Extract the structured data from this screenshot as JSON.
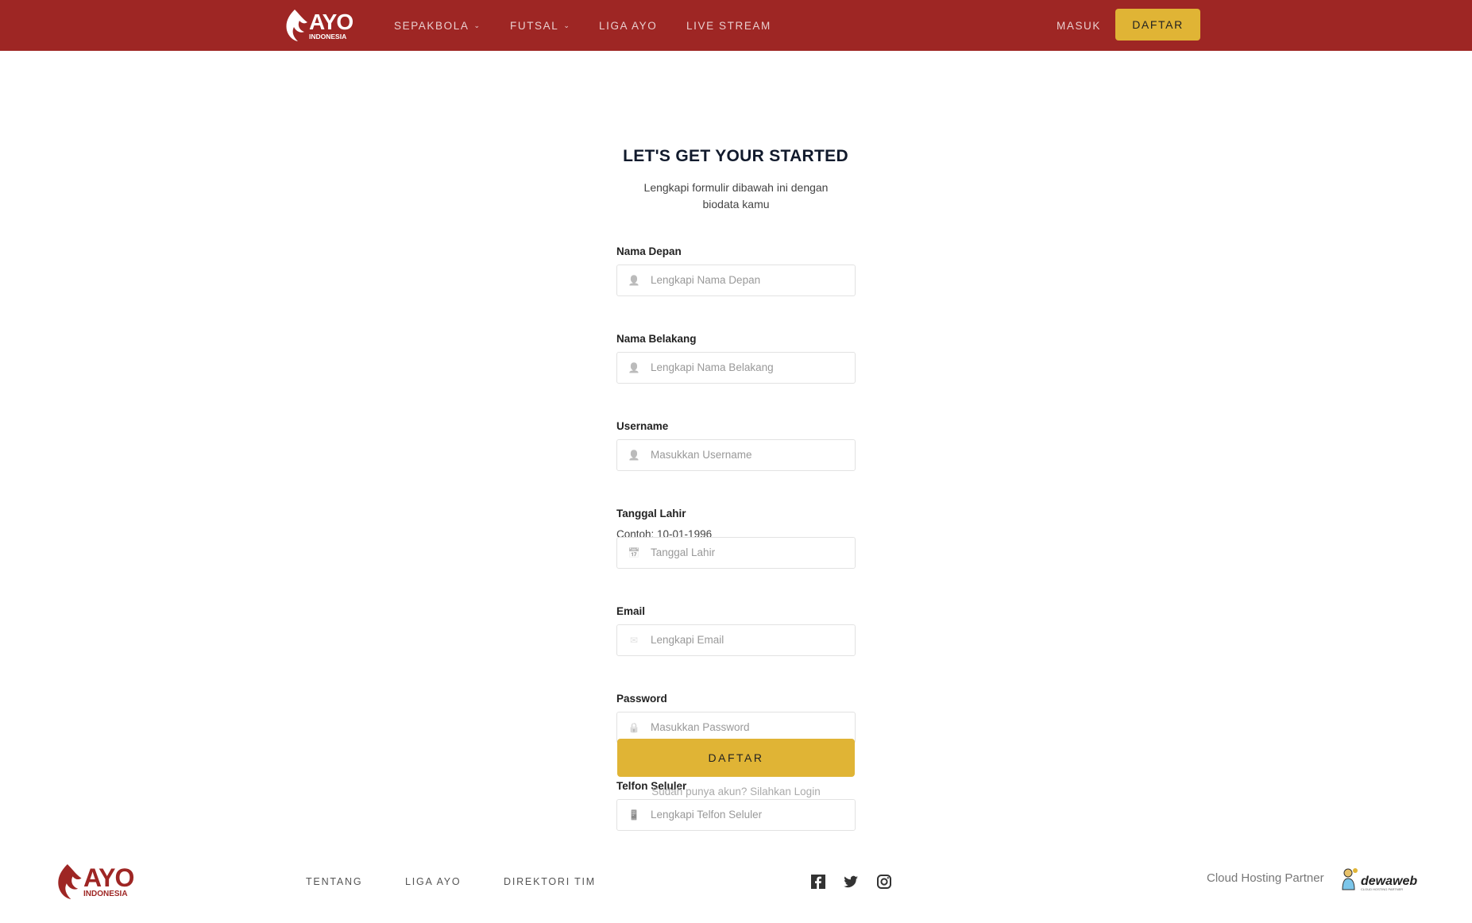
{
  "header": {
    "logo_main": "AYO",
    "logo_sub": "INDONESIA",
    "nav": [
      {
        "label": "SEPAKBOLA",
        "dropdown": true
      },
      {
        "label": "FUTSAL",
        "dropdown": true
      },
      {
        "label": "LIGA AYO"
      },
      {
        "label": "LIVE STREAM"
      }
    ],
    "login_label": "MASUK",
    "register_label": "DAFTAR"
  },
  "form": {
    "title": "LET'S GET YOUR STARTED",
    "subtitle_line1": "Lengkapi formulir dibawah ini dengan",
    "subtitle_line2": "biodata kamu",
    "fields": [
      {
        "label": "Nama Depan",
        "placeholder": "Lengkapi Nama Depan",
        "icon": "user-icon"
      },
      {
        "label": "Nama Belakang",
        "placeholder": "Lengkapi Nama Belakang",
        "icon": "user-icon"
      },
      {
        "label": "Username",
        "placeholder": "Masukkan Username",
        "icon": "user-icon"
      },
      {
        "label": "Tanggal Lahir",
        "hint": "Contoh: 10-01-1996",
        "placeholder": "Tanggal Lahir",
        "icon": "calendar-icon"
      },
      {
        "label": "Email",
        "placeholder": "Lengkapi Email",
        "icon": "envelope-icon"
      },
      {
        "label": "Password",
        "placeholder": "Masukkan Password",
        "icon": "lock-icon"
      },
      {
        "label": "Telfon Seluler",
        "placeholder": "Lengkapi Telfon Seluler",
        "icon": "mobile-icon"
      }
    ],
    "submit_label": "DAFTAR",
    "login_link": "Sudah punya akun? Silahkan Login"
  },
  "footer": {
    "logo_main": "AYO",
    "logo_sub": "INDONESIA",
    "links": [
      "TENTANG",
      "LIGA AYO",
      "DIREKTORI TIM"
    ],
    "social": [
      "facebook-icon",
      "twitter-icon",
      "instagram-icon"
    ],
    "partner_label": "Cloud Hosting Partner",
    "partner_name": "dewaweb",
    "partner_tagline": "CLOUD HOSTING PARTNER"
  },
  "colors": {
    "brand": "#9e2624",
    "accent": "#e0b435"
  }
}
